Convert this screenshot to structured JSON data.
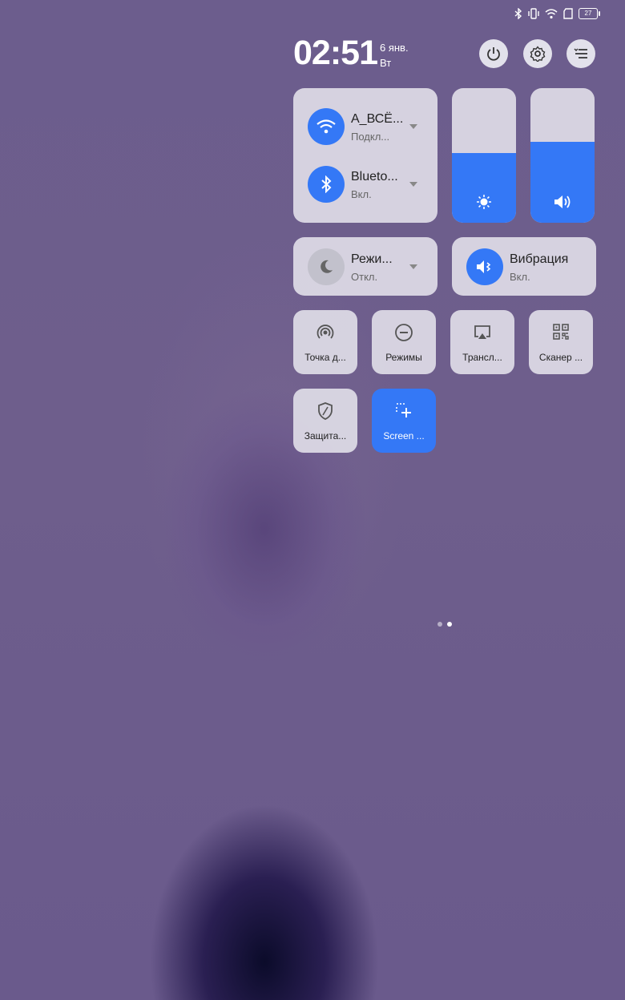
{
  "status_bar": {
    "battery_level": "27",
    "icons": [
      "bluetooth-icon",
      "vibrate-icon",
      "wifi-icon",
      "sim-icon",
      "battery-icon"
    ]
  },
  "header": {
    "time": "02:51",
    "date": "6 янв.",
    "weekday": "Вт"
  },
  "connectivity": {
    "wifi": {
      "name": "A_ВСЁ...",
      "status": "Подкл..."
    },
    "bluetooth": {
      "name": "Blueto...",
      "status": "Вкл."
    }
  },
  "sliders": {
    "brightness_level": 0.52,
    "volume_level": 0.6
  },
  "mode_card": {
    "name": "Режи...",
    "status": "Откл."
  },
  "vibration_card": {
    "name": "Вибрация",
    "status": "Вкл."
  },
  "tiles": [
    {
      "label": "Точка д...",
      "icon": "hotspot-icon",
      "active": false
    },
    {
      "label": "Режимы",
      "icon": "modes-icon",
      "active": false
    },
    {
      "label": "Трансл...",
      "icon": "cast-icon",
      "active": false
    },
    {
      "label": "Сканер ...",
      "icon": "qr-scanner-icon",
      "active": false
    },
    {
      "label": "Защита...",
      "icon": "shield-icon",
      "active": false
    },
    {
      "label": "Screen ...",
      "icon": "screenshot-icon",
      "active": true
    }
  ],
  "colors": {
    "accent": "#3478f6",
    "card": "#dedce6"
  },
  "page_indicator": {
    "pages": 2,
    "current": 2
  }
}
